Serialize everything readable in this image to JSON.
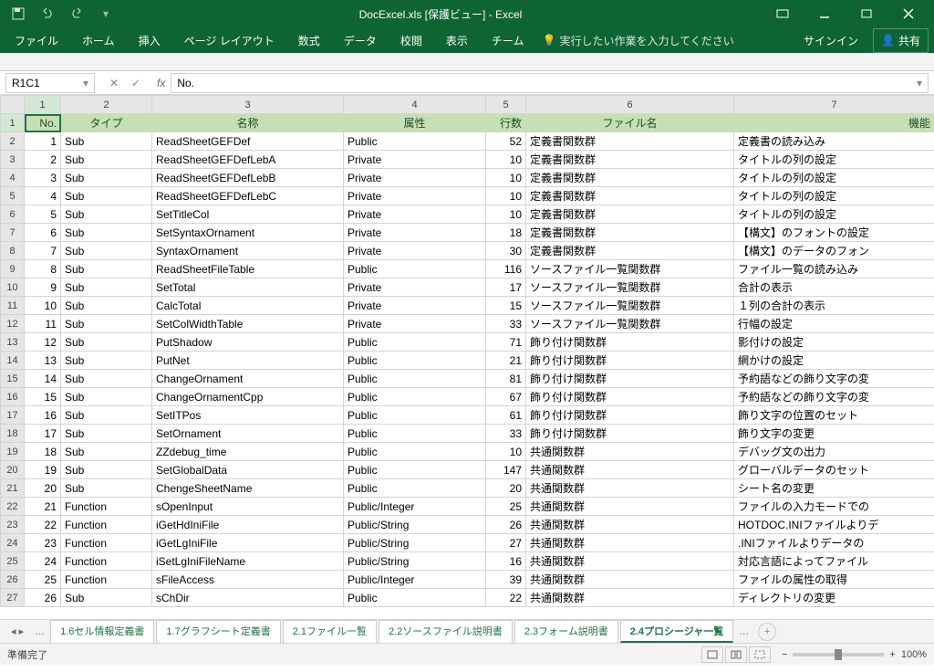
{
  "title": "DocExcel.xls  [保護ビュー] - Excel",
  "qat": {
    "save": "save",
    "undo": "undo",
    "redo": "redo"
  },
  "ribbon": [
    "ファイル",
    "ホーム",
    "挿入",
    "ページ レイアウト",
    "数式",
    "データ",
    "校閲",
    "表示",
    "チーム"
  ],
  "tellme": "実行したい作業を入力してください",
  "signin": "サインイン",
  "share": "共有",
  "namebox": "R1C1",
  "formula": "No.",
  "colnums": [
    "",
    "1",
    "2",
    "3",
    "4",
    "5",
    "6",
    "7"
  ],
  "headers": {
    "no": "No.",
    "type": "タイプ",
    "name": "名称",
    "attr": "属性",
    "lines": "行数",
    "file": "ファイル名",
    "func": "機能"
  },
  "rows": [
    {
      "r": 2,
      "no": 1,
      "type": "Sub",
      "name": "ReadSheetGEFDef",
      "attr": "Public",
      "lines": 52,
      "file": "定義書関数群",
      "func": "定義書の読み込み"
    },
    {
      "r": 3,
      "no": 2,
      "type": "Sub",
      "name": "ReadSheetGEFDefLebA",
      "attr": "Private",
      "lines": 10,
      "file": "定義書関数群",
      "func": "タイトルの列の設定"
    },
    {
      "r": 4,
      "no": 3,
      "type": "Sub",
      "name": "ReadSheetGEFDefLebB",
      "attr": "Private",
      "lines": 10,
      "file": "定義書関数群",
      "func": "タイトルの列の設定"
    },
    {
      "r": 5,
      "no": 4,
      "type": "Sub",
      "name": "ReadSheetGEFDefLebC",
      "attr": "Private",
      "lines": 10,
      "file": "定義書関数群",
      "func": "タイトルの列の設定"
    },
    {
      "r": 6,
      "no": 5,
      "type": "Sub",
      "name": "SetTitleCol",
      "attr": "Private",
      "lines": 10,
      "file": "定義書関数群",
      "func": "タイトルの列の設定"
    },
    {
      "r": 7,
      "no": 6,
      "type": "Sub",
      "name": "SetSyntaxOrnament",
      "attr": "Private",
      "lines": 18,
      "file": "定義書関数群",
      "func": "【構文】のフォントの設定"
    },
    {
      "r": 8,
      "no": 7,
      "type": "Sub",
      "name": "SyntaxOrnament",
      "attr": "Private",
      "lines": 30,
      "file": "定義書関数群",
      "func": "【構文】のデータのフォン"
    },
    {
      "r": 9,
      "no": 8,
      "type": "Sub",
      "name": "ReadSheetFileTable",
      "attr": "Public",
      "lines": 116,
      "file": "ソースファイル一覧関数群",
      "func": "ファイル一覧の読み込み"
    },
    {
      "r": 10,
      "no": 9,
      "type": "Sub",
      "name": "SetTotal",
      "attr": "Private",
      "lines": 17,
      "file": "ソースファイル一覧関数群",
      "func": "合計の表示"
    },
    {
      "r": 11,
      "no": 10,
      "type": "Sub",
      "name": "CalcTotal",
      "attr": "Private",
      "lines": 15,
      "file": "ソースファイル一覧関数群",
      "func": "１列の合計の表示"
    },
    {
      "r": 12,
      "no": 11,
      "type": "Sub",
      "name": "SetColWidthTable",
      "attr": "Private",
      "lines": 33,
      "file": "ソースファイル一覧関数群",
      "func": "行幅の設定"
    },
    {
      "r": 13,
      "no": 12,
      "type": "Sub",
      "name": "PutShadow",
      "attr": "Public",
      "lines": 71,
      "file": "飾り付け関数群",
      "func": "影付けの設定"
    },
    {
      "r": 14,
      "no": 13,
      "type": "Sub",
      "name": "PutNet",
      "attr": "Public",
      "lines": 21,
      "file": "飾り付け関数群",
      "func": "網かけの設定"
    },
    {
      "r": 15,
      "no": 14,
      "type": "Sub",
      "name": "ChangeOrnament",
      "attr": "Public",
      "lines": 81,
      "file": "飾り付け関数群",
      "func": "予約語などの飾り文字の変"
    },
    {
      "r": 16,
      "no": 15,
      "type": "Sub",
      "name": "ChangeOrnamentCpp",
      "attr": "Public",
      "lines": 67,
      "file": "飾り付け関数群",
      "func": "予約語などの飾り文字の変"
    },
    {
      "r": 17,
      "no": 16,
      "type": "Sub",
      "name": "SetITPos",
      "attr": "Public",
      "lines": 61,
      "file": "飾り付け関数群",
      "func": "飾り文字の位置のセット"
    },
    {
      "r": 18,
      "no": 17,
      "type": "Sub",
      "name": "SetOrnament",
      "attr": "Public",
      "lines": 33,
      "file": "飾り付け関数群",
      "func": "飾り文字の変更"
    },
    {
      "r": 19,
      "no": 18,
      "type": "Sub",
      "name": "ZZdebug_time",
      "attr": "Public",
      "lines": 10,
      "file": "共通関数群",
      "func": "デバッグ文の出力"
    },
    {
      "r": 20,
      "no": 19,
      "type": "Sub",
      "name": "SetGlobalData",
      "attr": "Public",
      "lines": 147,
      "file": "共通関数群",
      "func": "グローバルデータのセット"
    },
    {
      "r": 21,
      "no": 20,
      "type": "Sub",
      "name": "ChengeSheetName",
      "attr": "Public",
      "lines": 20,
      "file": "共通関数群",
      "func": "シート名の変更"
    },
    {
      "r": 22,
      "no": 21,
      "type": "Function",
      "name": "sOpenInput",
      "attr": "Public/Integer",
      "lines": 25,
      "file": "共通関数群",
      "func": "ファイルの入力モードでの"
    },
    {
      "r": 23,
      "no": 22,
      "type": "Function",
      "name": "iGetHdIniFile",
      "attr": "Public/String",
      "lines": 26,
      "file": "共通関数群",
      "func": "HOTDOC.INIファイルよりデ"
    },
    {
      "r": 24,
      "no": 23,
      "type": "Function",
      "name": "iGetLgIniFile",
      "attr": "Public/String",
      "lines": 27,
      "file": "共通関数群",
      "func": ".INIファイルよりデータの"
    },
    {
      "r": 25,
      "no": 24,
      "type": "Function",
      "name": "iSetLgIniFileName",
      "attr": "Public/String",
      "lines": 16,
      "file": "共通関数群",
      "func": "対応言語によってファイル"
    },
    {
      "r": 26,
      "no": 25,
      "type": "Function",
      "name": "sFileAccess",
      "attr": "Public/Integer",
      "lines": 39,
      "file": "共通関数群",
      "func": "ファイルの属性の取得"
    },
    {
      "r": 27,
      "no": 26,
      "type": "Sub",
      "name": "sChDir",
      "attr": "Public",
      "lines": 22,
      "file": "共通関数群",
      "func": "ディレクトリの変更"
    }
  ],
  "tabs": [
    "1.6セル情報定義書",
    "1.7グラフシート定義書",
    "2.1ファイル一覧",
    "2.2ソースファイル説明書",
    "2.3フォーム説明書",
    "2.4プロシージャ一覧"
  ],
  "tabs_active": 5,
  "status": "準備完了",
  "zoom": "100%"
}
